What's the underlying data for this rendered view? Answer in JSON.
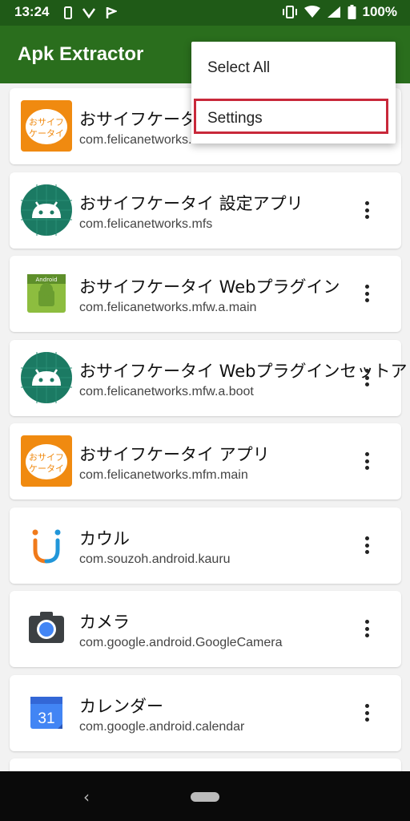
{
  "status_bar": {
    "time": "13:24",
    "battery": "100%"
  },
  "app_bar": {
    "title": "Apk Extractor"
  },
  "menu": {
    "items": [
      "Select All",
      "Settings"
    ]
  },
  "apps": [
    {
      "name": "おサイフケータイ アプ",
      "package": "com.felicanetworks.mfm",
      "icon": "osaifu-orange"
    },
    {
      "name": "おサイフケータイ 設定アプリ",
      "package": "com.felicanetworks.mfs",
      "icon": "android-teal"
    },
    {
      "name": "おサイフケータイ Webプラグイン",
      "package": "com.felicanetworks.mfw.a.main",
      "icon": "android-generic"
    },
    {
      "name": "おサイフケータイ Webプラグインセットアップ",
      "package": "com.felicanetworks.mfw.a.boot",
      "icon": "android-teal"
    },
    {
      "name": "おサイフケータイ アプリ",
      "package": "com.felicanetworks.mfm.main",
      "icon": "osaifu-orange"
    },
    {
      "name": "カウル",
      "package": "com.souzoh.android.kauru",
      "icon": "kauru"
    },
    {
      "name": "カメラ",
      "package": "com.google.android.GoogleCamera",
      "icon": "camera"
    },
    {
      "name": "カレンダー",
      "package": "com.google.android.calendar",
      "icon": "calendar"
    }
  ],
  "icon_text": {
    "osaifu_line1": "おサイフ",
    "osaifu_line2": "ケータイ",
    "android_label": "Android",
    "calendar_day": "31"
  },
  "colors": {
    "status_bar": "#1f5a17",
    "app_bar": "#2a6e1d",
    "highlight_border": "#c8283a",
    "osaifu_orange": "#f08a10",
    "android_teal": "#1b7a63"
  }
}
